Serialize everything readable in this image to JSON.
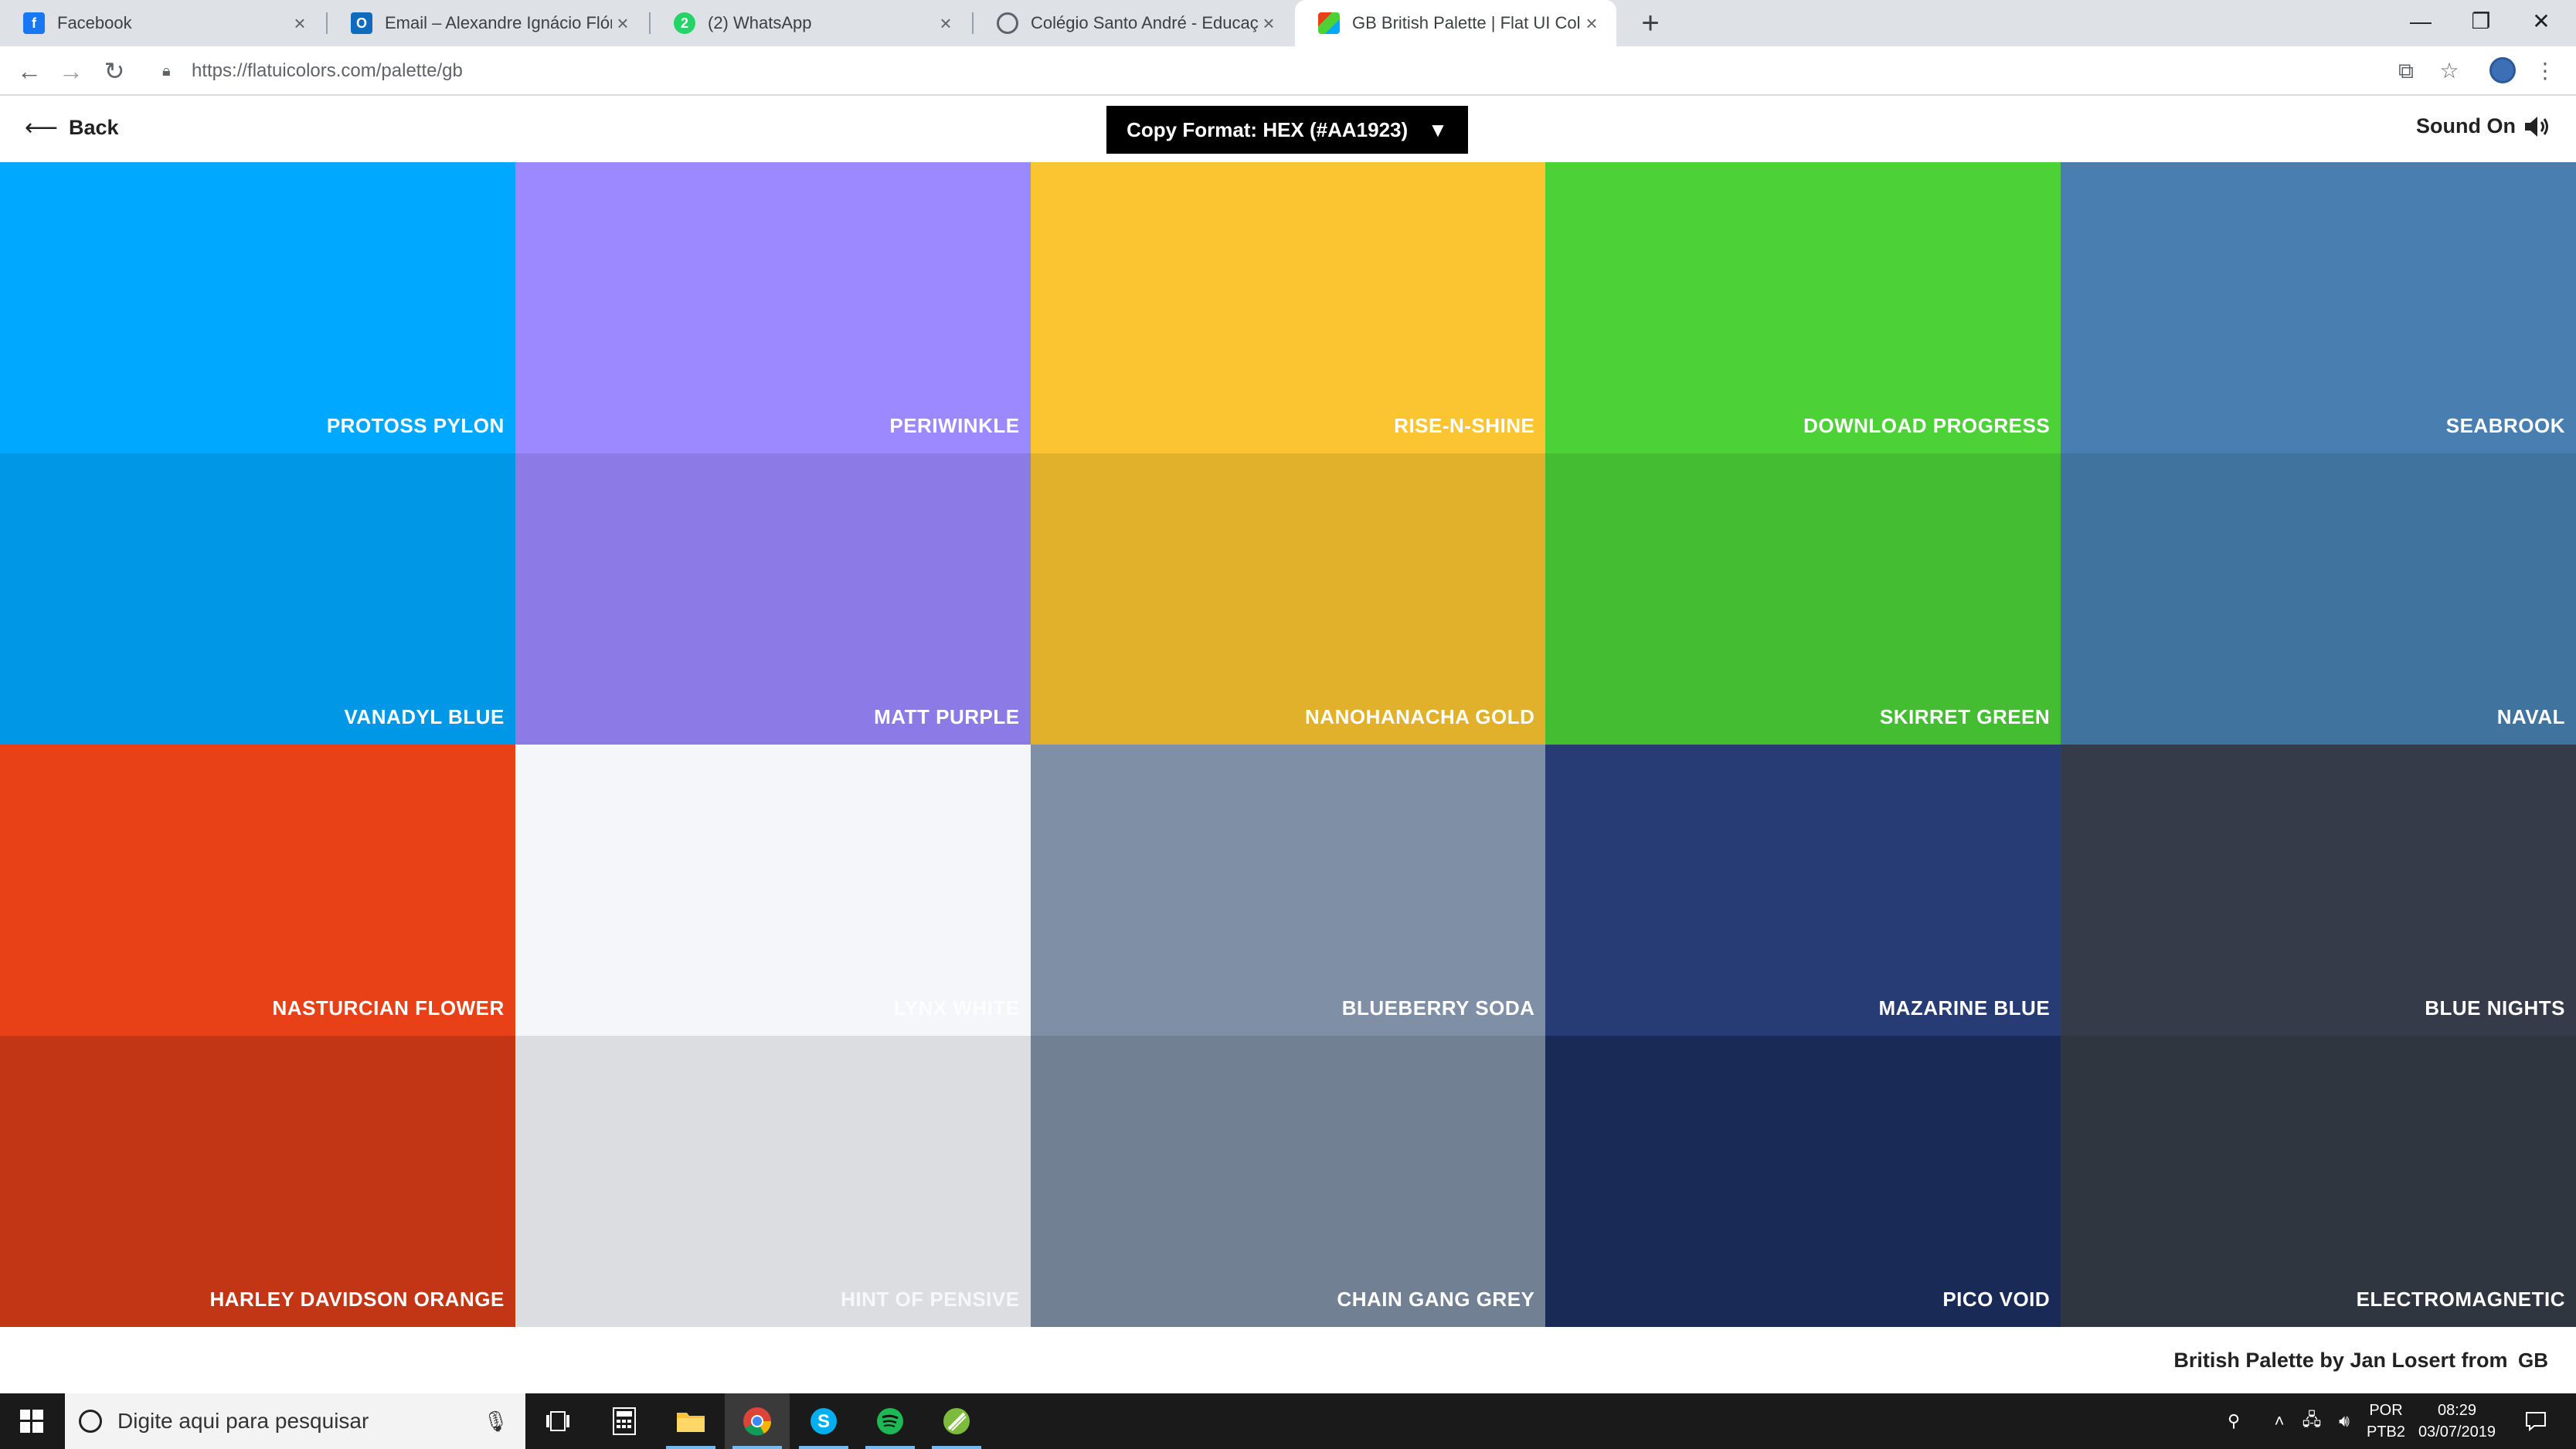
{
  "browser": {
    "tabs": [
      {
        "title": "Facebook",
        "icon": "facebook-icon",
        "color": "#1877f2"
      },
      {
        "title": "Email – Alexandre Ignácio Flório",
        "icon": "outlook-icon",
        "color": "#0f6cbd"
      },
      {
        "title": "(2) WhatsApp",
        "icon": "whatsapp-icon",
        "color": "#25d366"
      },
      {
        "title": "Colégio Santo André - Educação",
        "icon": "globe-icon",
        "color": "#5f6368"
      },
      {
        "title": "GB British Palette | Flat UI Colors",
        "icon": "flatuicolors-icon",
        "color": "#e84118"
      }
    ],
    "url": "https://flatuicolors.com/palette/gb"
  },
  "header": {
    "back_label": "Back",
    "format_label": "Copy Format: HEX (#AA1923)",
    "format_caret": "▼",
    "sound_label": "Sound On"
  },
  "palette": {
    "colors": [
      {
        "name": "PROTOSS PYLON",
        "hex": "#00a8ff"
      },
      {
        "name": "PERIWINKLE",
        "hex": "#9c88ff"
      },
      {
        "name": "RISE-N-SHINE",
        "hex": "#fbc531"
      },
      {
        "name": "DOWNLOAD PROGRESS",
        "hex": "#4cd137"
      },
      {
        "name": "SEABROOK",
        "hex": "#487eb0"
      },
      {
        "name": "VANADYL BLUE",
        "hex": "#0097e6"
      },
      {
        "name": "MATT PURPLE",
        "hex": "#8c7ae6"
      },
      {
        "name": "NANOHANACHA GOLD",
        "hex": "#e1b12c"
      },
      {
        "name": "SKIRRET GREEN",
        "hex": "#44bd32"
      },
      {
        "name": "NAVAL",
        "hex": "#40739e"
      },
      {
        "name": "NASTURCIAN FLOWER",
        "hex": "#e84118"
      },
      {
        "name": "LYNX WHITE",
        "hex": "#f5f6fa"
      },
      {
        "name": "BLUEBERRY SODA",
        "hex": "#7f8fa6"
      },
      {
        "name": "MAZARINE BLUE",
        "hex": "#273c75"
      },
      {
        "name": "BLUE NIGHTS",
        "hex": "#353b48"
      },
      {
        "name": "HARLEY DAVIDSON ORANGE",
        "hex": "#c23616"
      },
      {
        "name": "HINT OF PENSIVE",
        "hex": "#dcdde1"
      },
      {
        "name": "CHAIN GANG GREY",
        "hex": "#718093"
      },
      {
        "name": "PICO VOID",
        "hex": "#192a56"
      },
      {
        "name": "ELECTROMAGNETIC",
        "hex": "#2f3640"
      }
    ]
  },
  "footer": {
    "credit": "British Palette by Jan Losert from",
    "country_code": "GB"
  },
  "taskbar": {
    "search_placeholder": "Digite aqui para pesquisar",
    "lang_top": "POR",
    "lang_bottom": "PTB2",
    "time": "08:29",
    "date": "03/07/2019"
  }
}
